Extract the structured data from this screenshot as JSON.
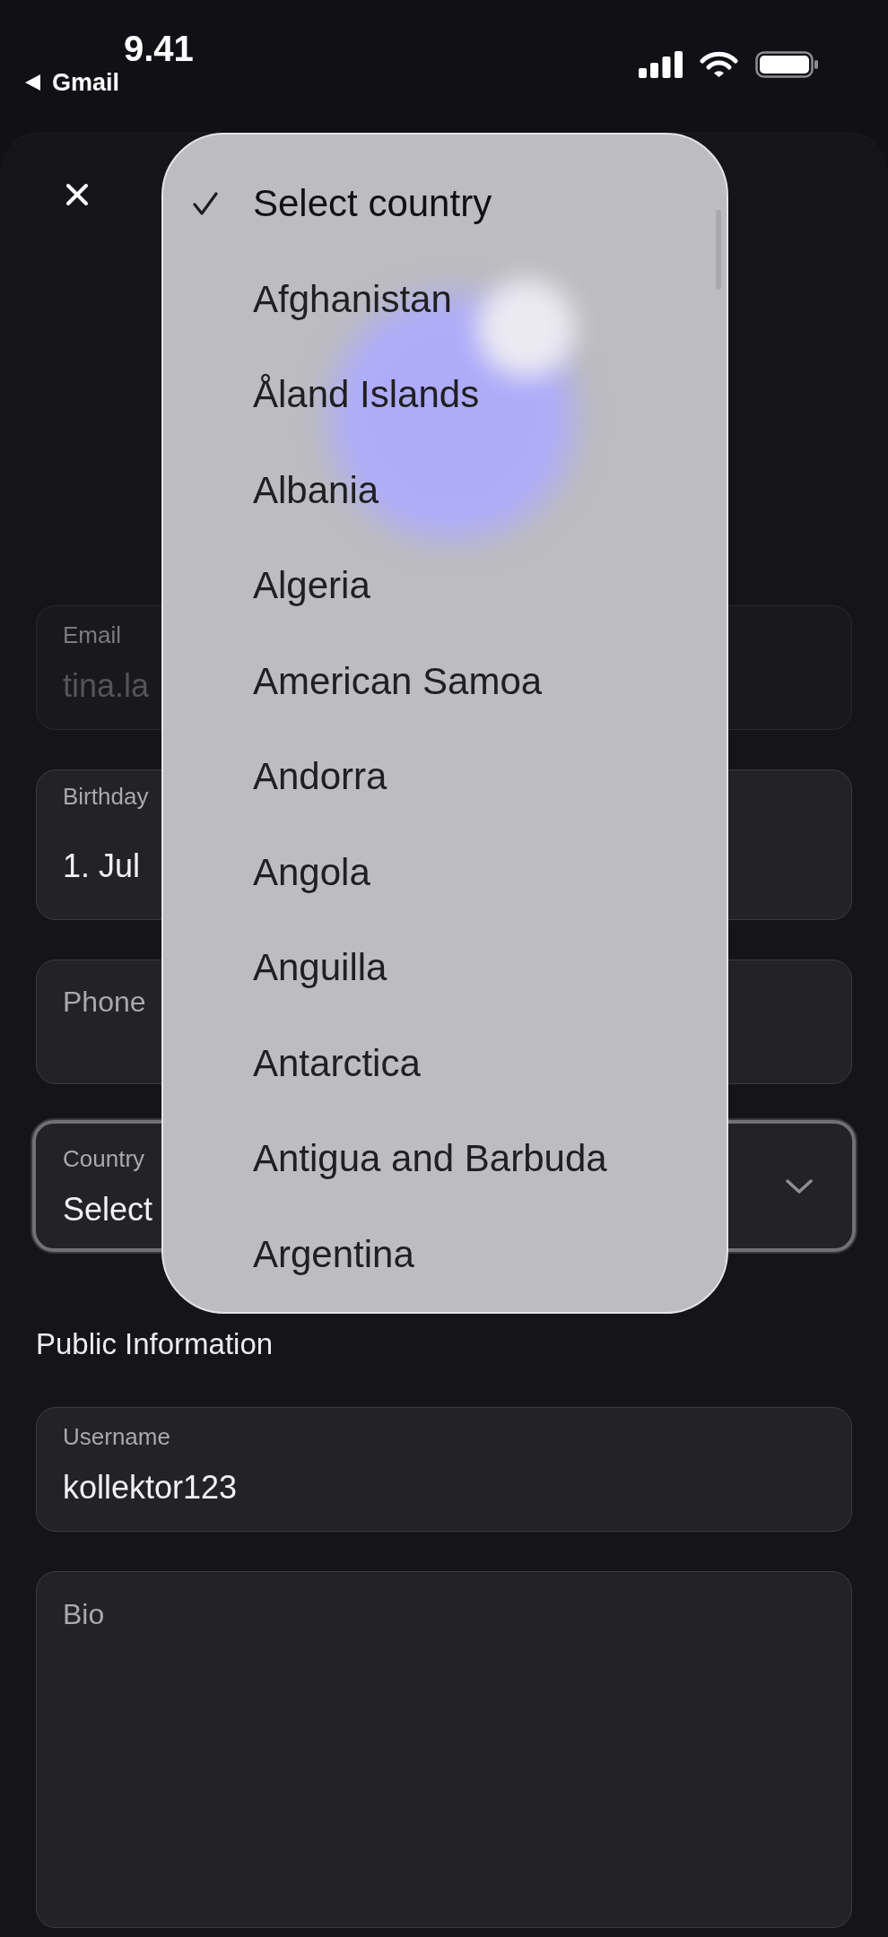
{
  "status_bar": {
    "time": "9.41",
    "back_label": "Gmail"
  },
  "form": {
    "fields": [
      {
        "kind": "text",
        "label": "Email",
        "value": "tina.la",
        "disabled": true,
        "focused": false
      },
      {
        "kind": "date",
        "label": "Birthday",
        "value": "1. Jul",
        "disabled": false,
        "focused": false
      },
      {
        "kind": "empty",
        "label": "Phone",
        "disabled": false,
        "focused": false
      },
      {
        "kind": "select",
        "label": "Country",
        "value": "Select",
        "disabled": false,
        "focused": true
      }
    ],
    "section_title": "Public Information",
    "public_fields": [
      {
        "kind": "text",
        "label": "Username",
        "value": "kollektor123",
        "disabled": false,
        "focused": false
      },
      {
        "kind": "textarea",
        "label": "Bio",
        "disabled": false,
        "focused": false
      }
    ]
  },
  "dropdown": {
    "options": [
      {
        "label": "Select country",
        "selected": true
      },
      {
        "label": "Afghanistan",
        "selected": false
      },
      {
        "label": "Åland Islands",
        "selected": false
      },
      {
        "label": "Albania",
        "selected": false
      },
      {
        "label": "Algeria",
        "selected": false
      },
      {
        "label": "American Samoa",
        "selected": false
      },
      {
        "label": "Andorra",
        "selected": false
      },
      {
        "label": "Angola",
        "selected": false
      },
      {
        "label": "Anguilla",
        "selected": false
      },
      {
        "label": "Antarctica",
        "selected": false
      },
      {
        "label": "Antigua and Barbuda",
        "selected": false
      },
      {
        "label": "Argentina",
        "selected": false
      }
    ]
  }
}
